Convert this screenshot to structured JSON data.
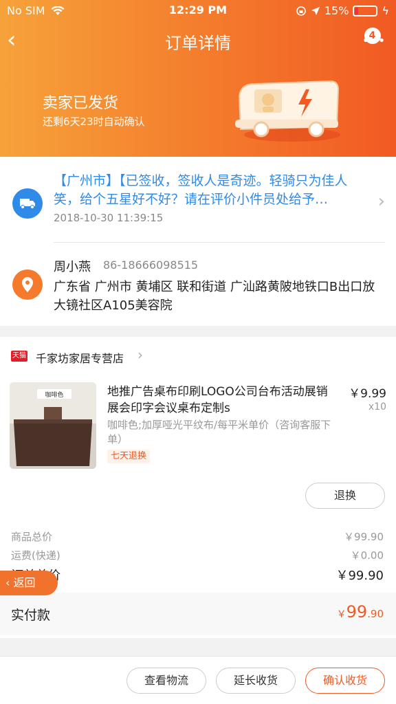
{
  "status_bar": {
    "carrier": "No SIM",
    "time": "12:29 PM",
    "battery": "15%"
  },
  "nav": {
    "title": "订单详情",
    "back_glyph": "‹",
    "more_glyph": "•••",
    "badge_count": "4"
  },
  "order_status": {
    "title": "卖家已发货",
    "subtitle": "还剩6天23时自动确认"
  },
  "logistics": {
    "icon": "truck-icon",
    "text": "【广州市】【已签收，签收人是奇迹。轻骑只为佳人笑，给个五星好不好？请在评价小件员处给予…",
    "time": "2018-10-30 11:39:15"
  },
  "address": {
    "icon": "location-pin-icon",
    "name": "周小燕",
    "phone": "86-18666098515",
    "detail": "广东省 广州市 黄埔区 联和街道 广汕路黄陂地铁口B出口放大镜社区A105美容院"
  },
  "store": {
    "badge": "天猫",
    "name": "千家坊家居专营店"
  },
  "product": {
    "image_label": "咖啡色",
    "title": "地推广告桌布印刷LOGO公司台布活动展销展会印字会议桌布定制s",
    "price": "￥9.99",
    "quantity": "x10",
    "spec": "咖啡色;加厚哑光平纹布/每平米单价（咨询客服下单）",
    "tag": "七天退换",
    "return_button": "退换"
  },
  "summary": {
    "goods_total_label": "商品总价",
    "goods_total_value": "￥99.90",
    "shipping_label": "运费(快递)",
    "shipping_value": "￥0.00",
    "order_total_label": "订单总价",
    "order_total_value": "￥99.90",
    "paid_label": "实付款",
    "paid_symbol": "￥",
    "paid_int": "99",
    "paid_dec": ".90"
  },
  "float_back": {
    "label": "返回"
  },
  "actions": {
    "logistics": "查看物流",
    "extend": "延长收货",
    "confirm": "确认收货"
  },
  "colors": {
    "accent": "#f15a23",
    "link_blue": "#2f8ae8"
  }
}
